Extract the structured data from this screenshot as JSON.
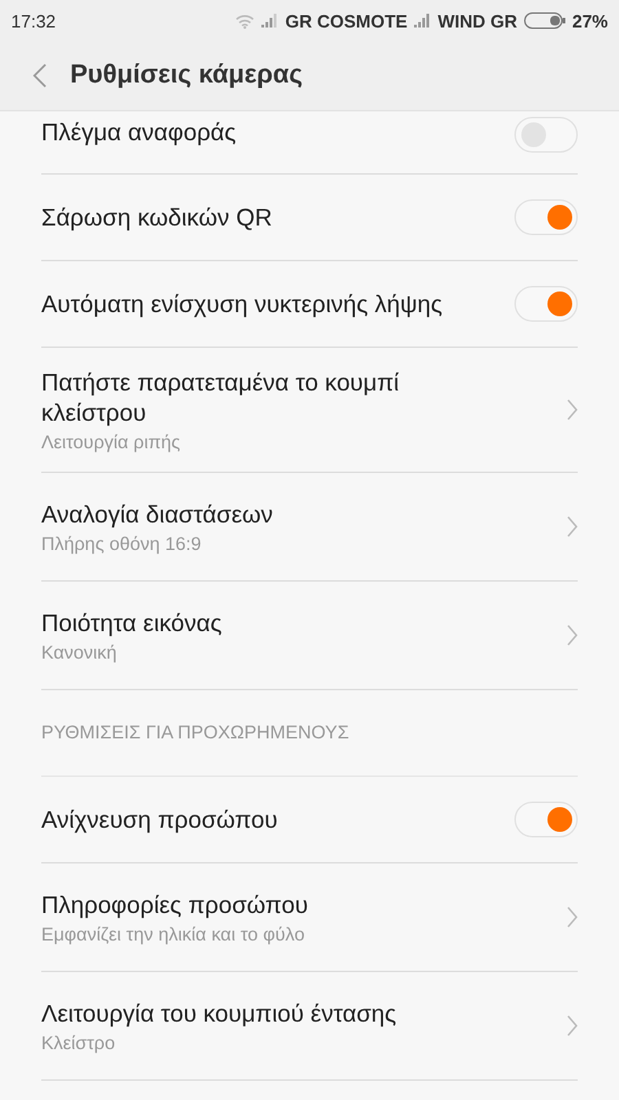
{
  "status_bar": {
    "time": "17:32",
    "carrier_1": "GR COSMOTE",
    "carrier_2": "WIND GR",
    "battery": "27%"
  },
  "header": {
    "title": "Ρυθμίσεις κάμερας"
  },
  "sections": [
    {
      "items": [
        {
          "kind": "toggle",
          "label": "Πλέγμα αναφοράς",
          "on": false
        },
        {
          "kind": "toggle",
          "label": "Σάρωση κωδικών QR",
          "on": true
        },
        {
          "kind": "toggle",
          "label": "Αυτόματη ενίσχυση νυκτερινής λήψης",
          "on": true
        },
        {
          "kind": "link",
          "label": "Πατήστε παρατεταμένα το κουμπί κλείστρου",
          "value": "Λειτουργία ριπής"
        },
        {
          "kind": "link",
          "label": "Αναλογία διαστάσεων",
          "value": "Πλήρης οθόνη 16:9"
        },
        {
          "kind": "link",
          "label": "Ποιότητα εικόνας",
          "value": "Κανονική"
        }
      ]
    },
    {
      "title": "ΡΥΘΜΙΣΕΙΣ ΓΙΑ ΠΡΟΧΩΡΗΜΕΝΟΥΣ",
      "items": [
        {
          "kind": "toggle",
          "label": "Ανίχνευση προσώπου",
          "on": true
        },
        {
          "kind": "link",
          "label": "Πληροφορίες προσώπου",
          "value": "Εμφανίζει την ηλικία και το φύλο"
        },
        {
          "kind": "link",
          "label": "Λειτουργία του κουμπιού έντασης",
          "value": "Κλείστρο"
        }
      ]
    }
  ]
}
